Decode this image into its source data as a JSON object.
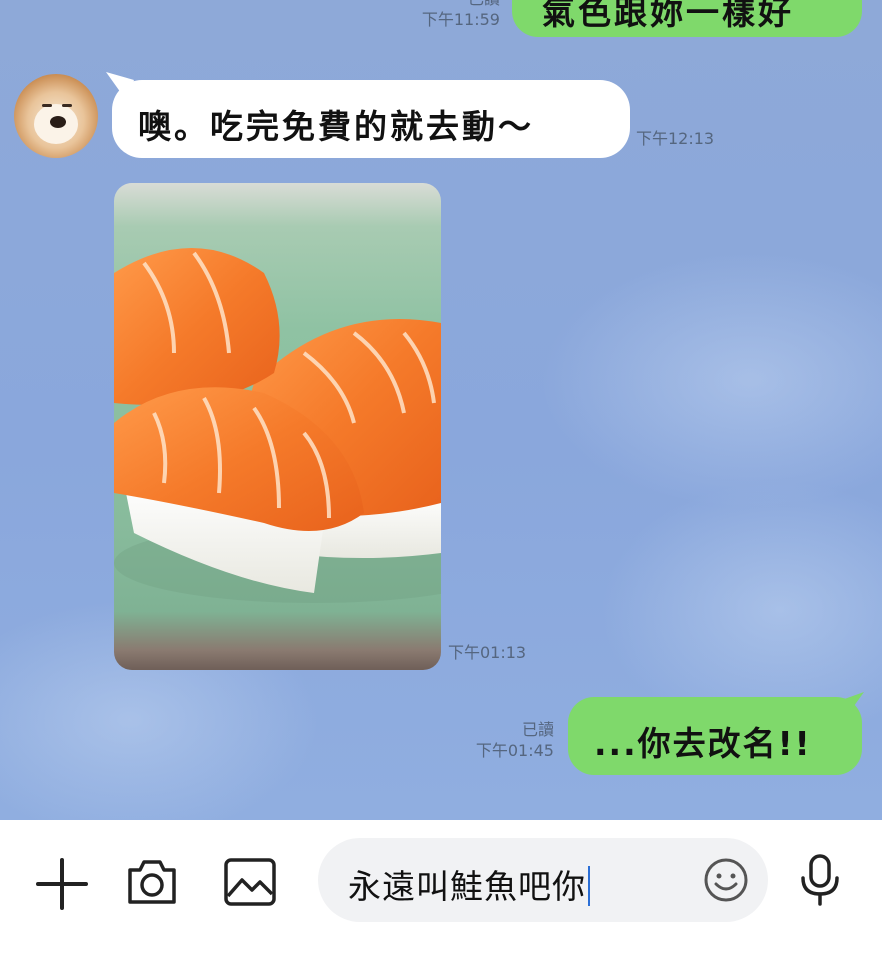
{
  "messages": [
    {
      "type": "outgoing",
      "text": "氣色跟妳一樣好",
      "read": "已讀",
      "time": "下午11:59"
    },
    {
      "type": "incoming",
      "text": "噢。吃完免費的就去動～",
      "time": "下午12:13"
    },
    {
      "type": "incoming-image",
      "image": "salmon sushi photo",
      "time": "下午01:13"
    },
    {
      "type": "outgoing",
      "text": "...你去改名!!",
      "read": "已讀",
      "time": "下午01:45"
    }
  ],
  "input": {
    "value": "永遠叫鮭魚吧你"
  },
  "icons": {
    "add": "plus-icon",
    "camera": "camera-icon",
    "gallery": "image-icon",
    "emoji": "emoji-icon",
    "mic": "microphone-icon"
  },
  "colors": {
    "outgoing_bubble": "#7fd96b",
    "incoming_bubble": "#ffffff",
    "chat_background": "#8ea9d8"
  }
}
